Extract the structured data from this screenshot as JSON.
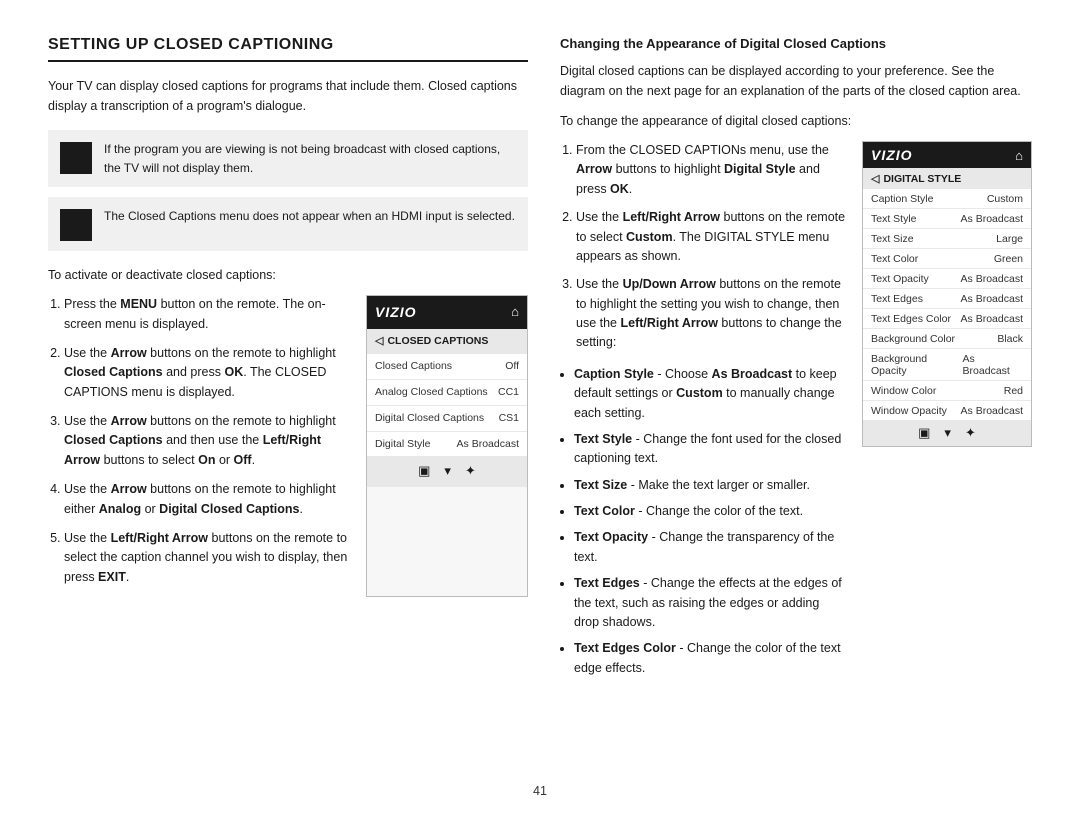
{
  "page": {
    "number": "41"
  },
  "left": {
    "title": "SETTING UP CLOSED CAPTIONING",
    "intro": "Your TV can display closed captions for programs that include them. Closed captions display a transcription of a program's dialogue.",
    "note1": "If the program you are viewing is not being broadcast with closed captions, the TV will not display them.",
    "note2": "The Closed Captions menu does not appear when an HDMI input is selected.",
    "steps_intro": "To activate or deactivate closed captions:",
    "steps": [
      {
        "text": "Press the ",
        "bold": "MENU",
        "rest": " button on the remote. The on-screen menu is displayed."
      },
      {
        "text": "Use the ",
        "bold": "Arrow",
        "rest": " buttons on the remote to highlight ",
        "bold2": "Closed Captions",
        "rest2": " and press ",
        "bold3": "OK",
        "rest3": ". The CLOSED CAPTIONS menu is displayed."
      },
      {
        "text": "Use the ",
        "bold": "Arrow",
        "rest": " buttons on the remote to highlight ",
        "bold2": "Closed Captions",
        "rest2": " and then use the ",
        "bold3": "Left/Right Arrow",
        "rest3": " buttons to select ",
        "bold4": "On",
        "rest4": " or ",
        "bold5": "Off",
        "rest5": "."
      },
      {
        "text": "Use the ",
        "bold": "Arrow",
        "rest": " buttons on the remote to highlight either ",
        "bold2": "Analog",
        "rest2": " or ",
        "bold3": "Digital Closed Captions",
        "rest3": "."
      },
      {
        "text": "Use the ",
        "bold": "Left/Right Arrow",
        "rest": " buttons on the remote to select the caption channel you wish to display, then press ",
        "bold2": "EXIT",
        "rest2": "."
      }
    ],
    "menu": {
      "logo": "VIZIO",
      "subtitle": "CLOSED CAPTIONS",
      "rows": [
        {
          "label": "Closed Captions",
          "value": "Off"
        },
        {
          "label": "Analog Closed Captions",
          "value": "CC1"
        },
        {
          "label": "Digital Closed Captions",
          "value": "CS1"
        },
        {
          "label": "Digital Style",
          "value": "As Broadcast"
        }
      ],
      "footer_icons": [
        "⬛",
        "🔽",
        "⚙"
      ]
    }
  },
  "right": {
    "title": "Changing the Appearance of Digital Closed Captions",
    "intro1": "Digital closed captions can be displayed according to your preference. See the diagram on the next page for an explanation of the parts of the closed caption area.",
    "intro2": "To change the appearance of digital closed captions:",
    "steps": [
      {
        "text": "From the CLOSED CAPTIONs menu, use the ",
        "bold": "Arrow",
        "rest": " buttons to highlight ",
        "bold2": "Digital Style",
        "rest2": " and press ",
        "bold3": "OK",
        "rest3": "."
      },
      {
        "text": "Use the ",
        "bold": "Left/Right Arrow",
        "rest": " buttons on the remote to select ",
        "bold2": "Custom",
        "rest2": ". The DIGITAL STYLE menu appears as shown."
      },
      {
        "text": "Use the ",
        "bold": "Up/Down Arrow",
        "rest": " buttons on the remote to highlight the setting you wish to change, then use the ",
        "bold2": "Left/Right Arrow",
        "rest2": " buttons to change the setting:"
      }
    ],
    "digital_menu": {
      "logo": "VIZIO",
      "subtitle": "DIGITAL STYLE",
      "rows": [
        {
          "label": "Caption Style",
          "value": "Custom"
        },
        {
          "label": "Text Style",
          "value": "As Broadcast"
        },
        {
          "label": "Text Size",
          "value": "Large"
        },
        {
          "label": "Text Color",
          "value": "Green"
        },
        {
          "label": "Text Opacity",
          "value": "As Broadcast"
        },
        {
          "label": "Text Edges",
          "value": "As Broadcast"
        },
        {
          "label": "Text Edges Color",
          "value": "As Broadcast"
        },
        {
          "label": "Background Color",
          "value": "Black"
        },
        {
          "label": "Background Opacity",
          "value": "As Broadcast"
        },
        {
          "label": "Window Color",
          "value": "Red"
        },
        {
          "label": "Window Opacity",
          "value": "As Broadcast"
        }
      ],
      "footer_icons": [
        "⬛",
        "🔽",
        "⚙"
      ]
    },
    "bullets": [
      {
        "bold": "Caption Style",
        "text": " - Choose ",
        "bold2": "As Broadcast",
        "text2": " to keep default settings or ",
        "bold3": "Custom",
        "text3": " to manually change each setting."
      },
      {
        "bold": "Text Style",
        "text": " - Change the font used for the closed captioning text."
      },
      {
        "bold": "Text Size",
        "text": " - Make the text larger or smaller."
      },
      {
        "bold": "Text Color",
        "text": " - Change the color of the text."
      },
      {
        "bold": "Text Opacity",
        "text": " - Change the transparency of the text."
      },
      {
        "bold": "Text Edges",
        "text": " - Change the effects at the edges of the text, such as raising the edges or adding drop shadows."
      },
      {
        "bold": "Text Edges Color",
        "text": " - Change the color of the text edge effects."
      }
    ]
  }
}
